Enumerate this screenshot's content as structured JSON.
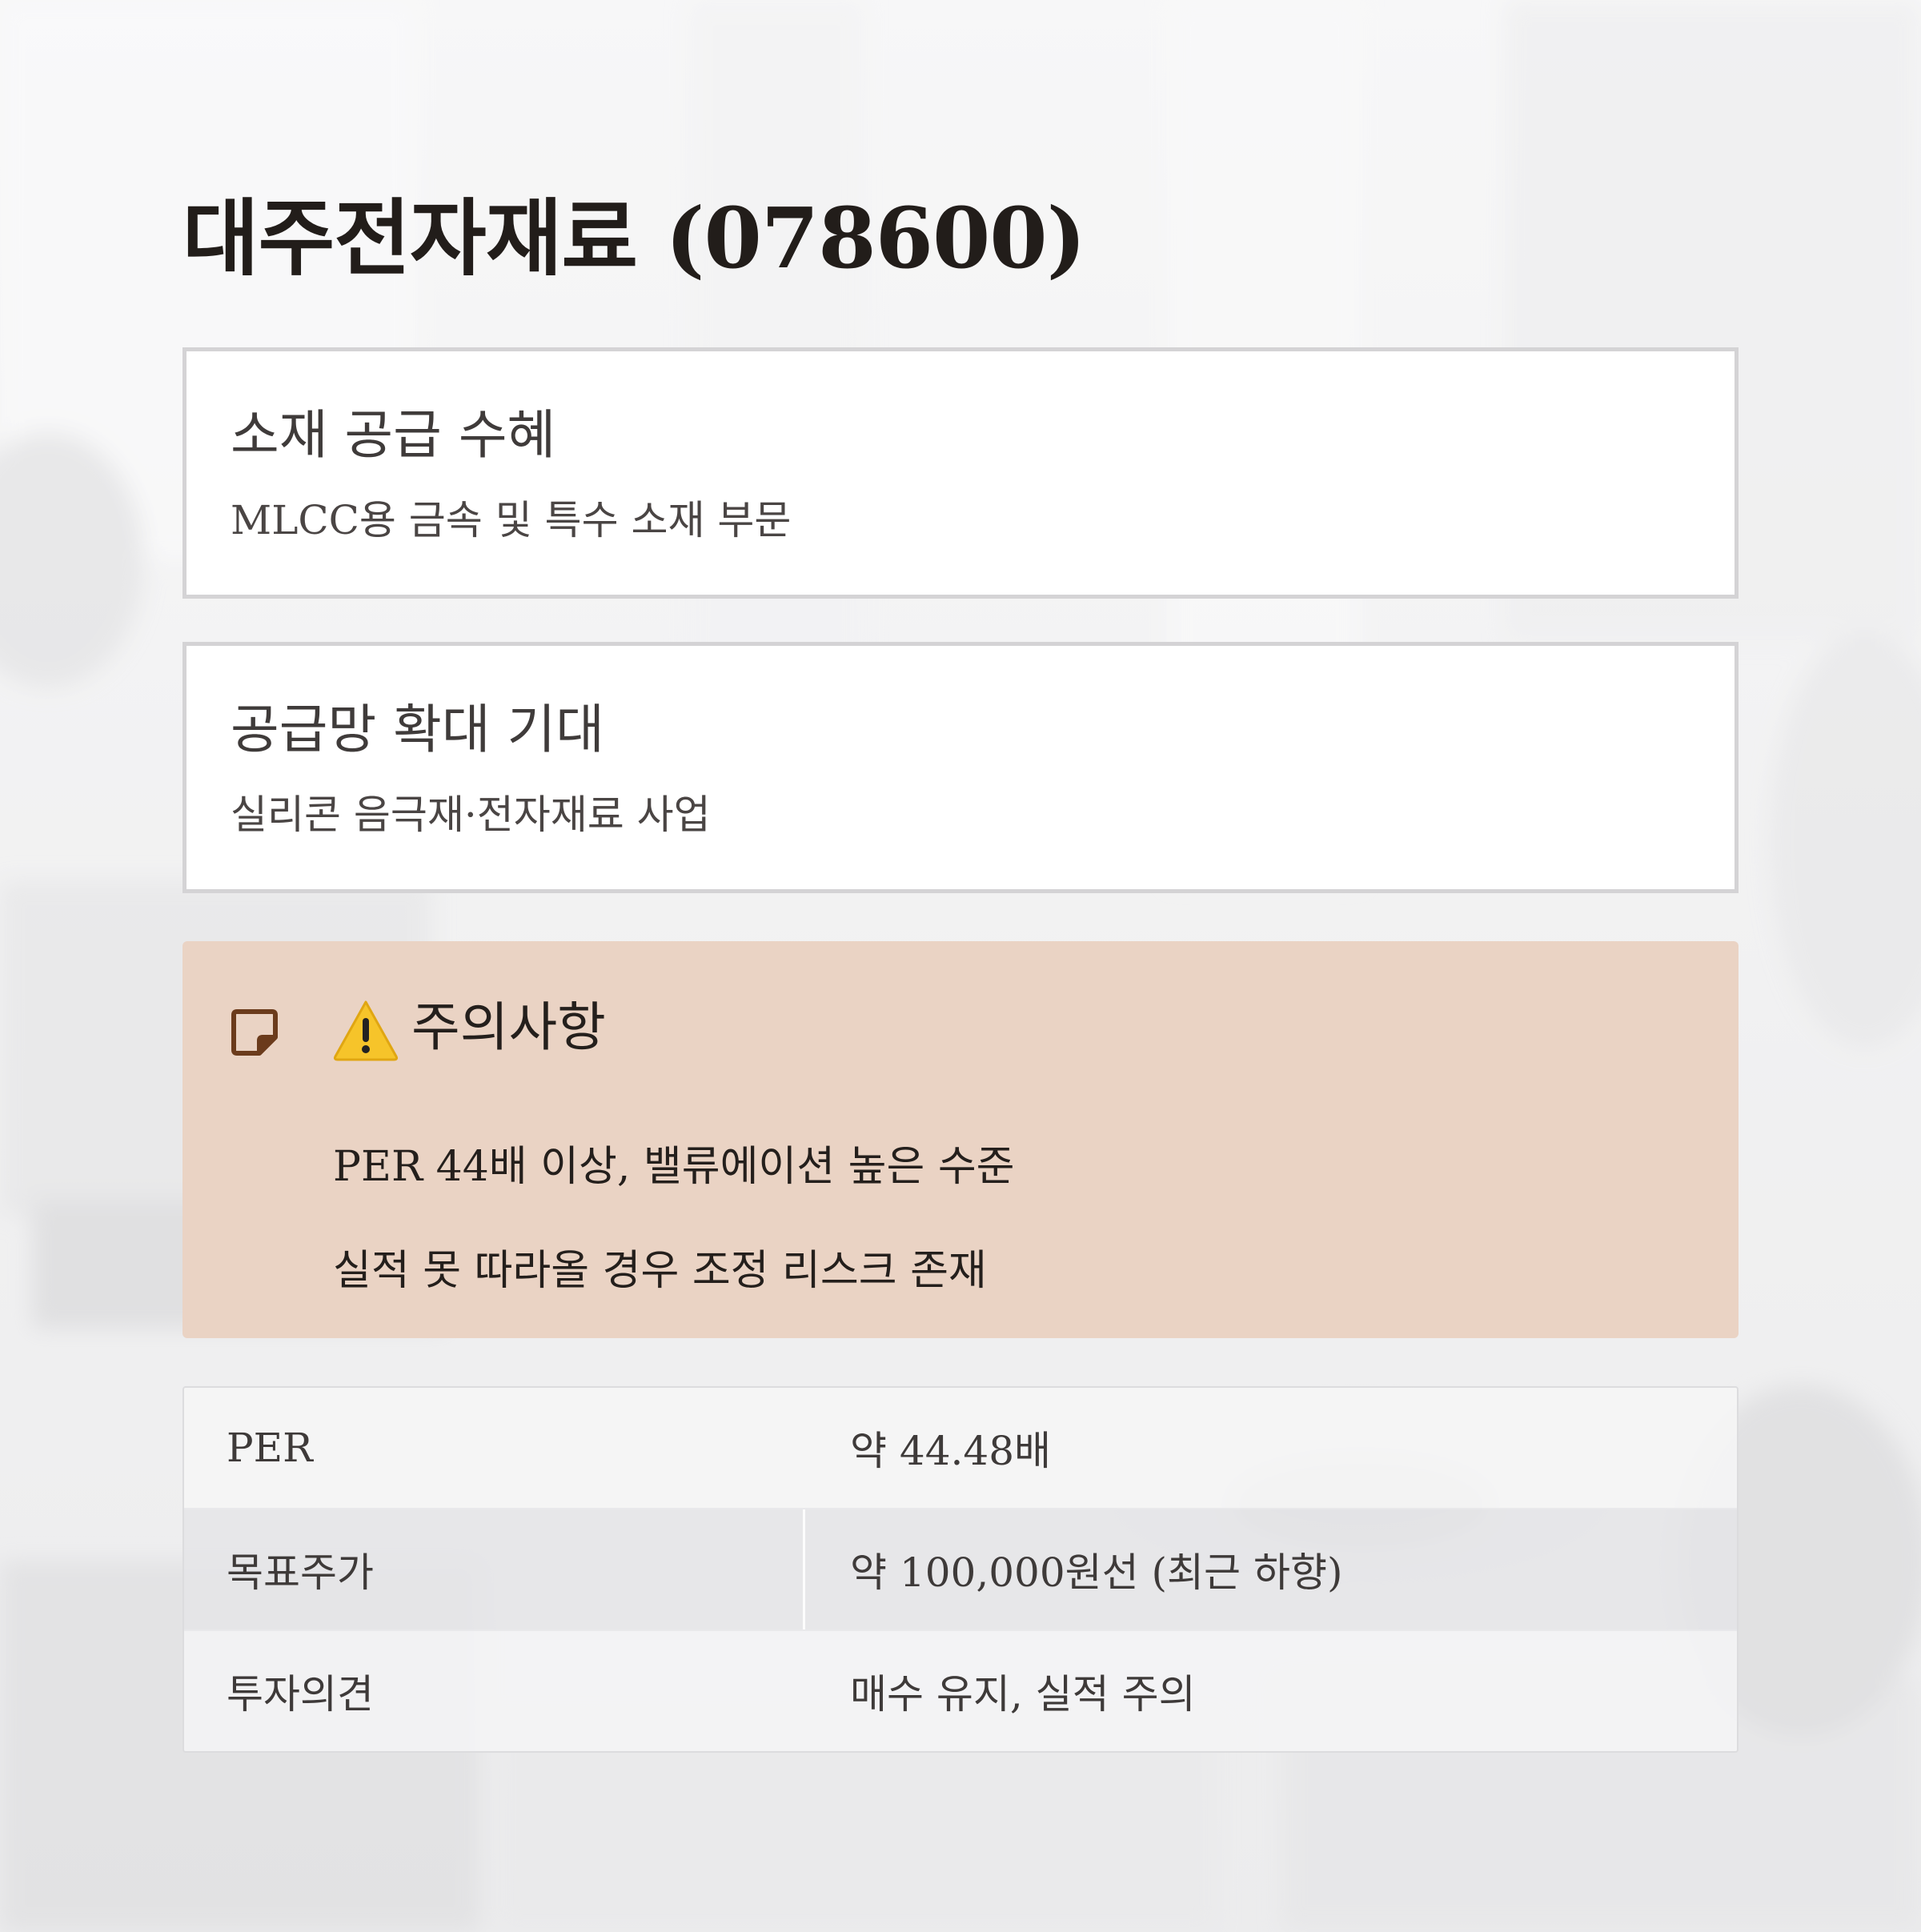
{
  "title": "대주전자재료 (078600)",
  "cards": [
    {
      "heading": "소재 공급 수혜",
      "text": "MLCC용 금속 및 특수 소재 부문"
    },
    {
      "heading": "공급망 확대 기대",
      "text": "실리콘 음극재·전자재료 사업"
    }
  ],
  "alert": {
    "note_icon": "note-icon",
    "warning_icon": "warning-icon",
    "heading": "주의사항",
    "lines": [
      "PER 44배 이상, 밸류에이션 높은 수준",
      "실적 못 따라올 경우 조정 리스크 존재"
    ],
    "background": "#ead3c4"
  },
  "table": {
    "rows": [
      {
        "label": "PER",
        "value": "약 44.48배"
      },
      {
        "label": "목표주가",
        "value": "약 100,000원선 (최근 하향)"
      },
      {
        "label": "투자의견",
        "value": "매수 유지, 실적 주의"
      }
    ]
  }
}
